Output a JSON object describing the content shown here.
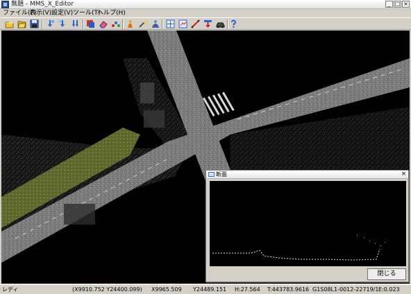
{
  "window": {
    "title": "無題 - MMS_X_Editor",
    "controls": {
      "minimize": "_",
      "maximize": "□",
      "close": "×"
    }
  },
  "menu": [
    {
      "label": "ファイル(F)",
      "name": "menu-file"
    },
    {
      "label": "表示(V)",
      "name": "menu-view"
    },
    {
      "label": "設定(V)",
      "name": "menu-settings"
    },
    {
      "label": "ツール(T)",
      "name": "menu-tools"
    },
    {
      "label": "ヘルプ(H)",
      "name": "menu-help"
    }
  ],
  "toolbar": {
    "icons": [
      "new-file-icon",
      "open-folder-icon",
      "save-icon",
      "marker-add-icon",
      "marker-down-icon",
      "marker-multi-icon",
      "layer-icon",
      "eraser-icon",
      "points-icon",
      "person-icon",
      "magic-wand-icon",
      "user-wave-icon",
      "crosshair-view-icon",
      "section-view-icon",
      "measure-line-icon",
      "download-icon",
      "car-icon",
      "help-icon"
    ]
  },
  "section_window": {
    "title": "断面",
    "close_glyph": "×",
    "close_button": "閉じる"
  },
  "status": {
    "state": "レディ",
    "cursor": "(X9910.752 Y24400.099)",
    "x": "X9965.509",
    "y": "Y24489.151",
    "h": "H:27.564",
    "t": "T:443783.9616",
    "frame": "G1S08L1-0012-22719/1",
    "e": "E:0.023"
  },
  "colors": {
    "window_face": "#d4d0c8",
    "viewport_bg": "#000000",
    "road": "#8e8e8e",
    "grass": "#6f7a3a",
    "section_profile": "#ffffff"
  }
}
